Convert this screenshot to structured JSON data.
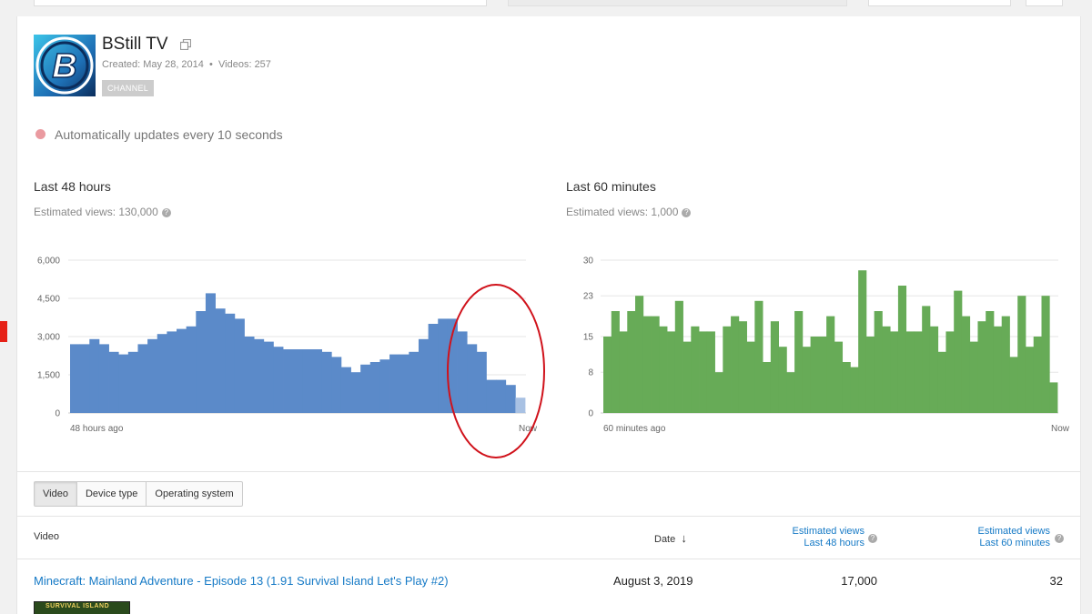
{
  "channel": {
    "name": "BStill TV",
    "created": "Created: May 28, 2014",
    "separator": "•",
    "videos": "Videos: 257",
    "badge": "CHANNEL",
    "avatar_letter": "B"
  },
  "auto_update": {
    "text": "Automatically updates every 10 seconds",
    "dot_color": "#ea9aa0"
  },
  "left_section": {
    "title": "Last 48 hours",
    "estimated": "Estimated views: 130,000"
  },
  "right_section": {
    "title": "Last 60 minutes",
    "estimated": "Estimated views: 1,000"
  },
  "chart_data": [
    {
      "type": "bar",
      "series_color": "#5b8ac9",
      "last_bar_color": "#a8c1e3",
      "ylim": [
        0,
        6000
      ],
      "yticks": [
        "6,000",
        "4,500",
        "3,000",
        "1,500",
        "0"
      ],
      "ytick_values": [
        6000,
        4500,
        3000,
        1500,
        0
      ],
      "xlabel_start": "48 hours ago",
      "xlabel_end": "Now",
      "values": [
        2700,
        2700,
        2900,
        2700,
        2400,
        2300,
        2400,
        2700,
        2900,
        3100,
        3200,
        3300,
        3400,
        4000,
        4700,
        4100,
        3900,
        3700,
        3000,
        2900,
        2800,
        2600,
        2500,
        2500,
        2500,
        2500,
        2400,
        2200,
        1800,
        1600,
        1900,
        2000,
        2100,
        2300,
        2300,
        2400,
        2900,
        3500,
        3700,
        3700,
        3200,
        2700,
        2400,
        1300,
        1300,
        1100,
        600
      ]
    },
    {
      "type": "bar",
      "series_color": "#67ab57",
      "ylim": [
        0,
        30
      ],
      "yticks": [
        "30",
        "23",
        "15",
        "8",
        "0"
      ],
      "ytick_values": [
        30,
        23,
        15,
        8,
        0
      ],
      "xlabel_start": "60 minutes ago",
      "xlabel_end": "Now",
      "values": [
        15,
        20,
        16,
        20,
        23,
        19,
        19,
        17,
        16,
        22,
        14,
        17,
        16,
        16,
        8,
        17,
        19,
        18,
        14,
        22,
        10,
        18,
        13,
        8,
        20,
        13,
        15,
        15,
        19,
        14,
        10,
        9,
        28,
        15,
        20,
        17,
        16,
        25,
        16,
        16,
        21,
        17,
        12,
        16,
        24,
        19,
        14,
        18,
        20,
        17,
        19,
        11,
        23,
        13,
        15,
        23,
        6
      ]
    }
  ],
  "tabs": [
    "Video",
    "Device type",
    "Operating system"
  ],
  "table": {
    "col_video": "Video",
    "col_date": "Date",
    "col_48_line1": "Estimated views",
    "col_48_line2": "Last 48 hours",
    "col_60_line1": "Estimated views",
    "col_60_line2": "Last 60 minutes",
    "rows": [
      {
        "title": "Minecraft: Mainland Adventure - Episode 13 (1.91 Survival Island Let's Play #2)",
        "date": "August 3, 2019",
        "views_48": "17,000",
        "views_60": "32",
        "thumb_text": "SURVIVAL ISLAND"
      }
    ]
  },
  "icons": {
    "help": "?",
    "sort_arrow": "↓"
  }
}
